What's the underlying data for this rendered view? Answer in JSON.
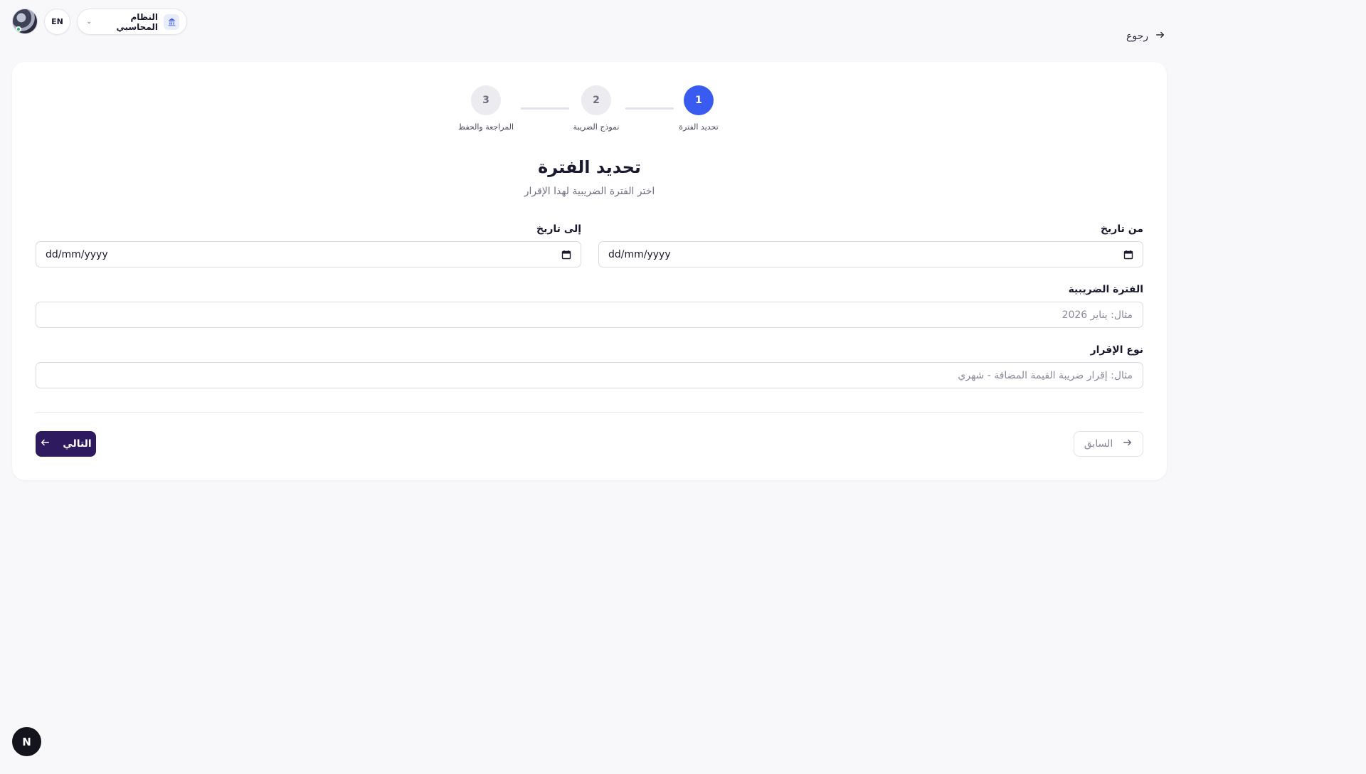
{
  "header": {
    "language_button": "EN",
    "system_selector": "النظام المحاسبي",
    "back_link": "رجوع"
  },
  "stepper": {
    "steps": [
      {
        "number": "1",
        "label": "تحديد الفترة",
        "active": true
      },
      {
        "number": "2",
        "label": "نموذج الضريبة",
        "active": false
      },
      {
        "number": "3",
        "label": "المراجعة والحفظ",
        "active": false
      }
    ]
  },
  "form": {
    "title": "تحديد الفترة",
    "subtitle": "اختر الفترة الضريبية لهذا الإقرار",
    "from_date": {
      "label": "من تاريخ",
      "value": "dd/mm/yyyy"
    },
    "to_date": {
      "label": "إلى تاريخ",
      "value": "dd/mm/yyyy"
    },
    "tax_period": {
      "label": "الفترة الضريبية",
      "placeholder": "مثال: يناير 2026"
    },
    "return_type": {
      "label": "نوع الإقرار",
      "placeholder": "مثال: إقرار ضريبة القيمة المضافة - شهري"
    }
  },
  "actions": {
    "previous": "السابق",
    "next": "التالي"
  },
  "fab": {
    "label": "N"
  },
  "colors": {
    "accent": "#3a5bf0",
    "primary_button": "#2e1a5e",
    "background": "#f8f8fb"
  }
}
